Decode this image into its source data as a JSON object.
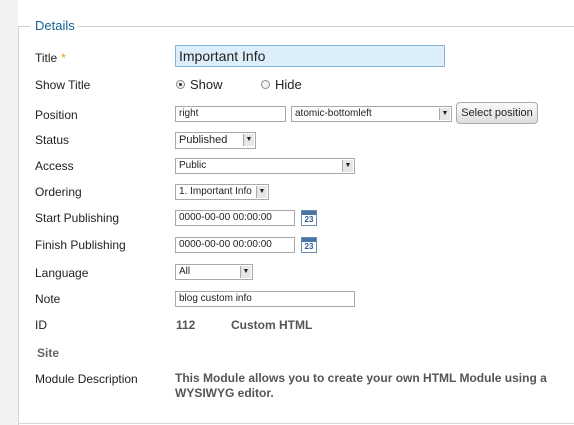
{
  "fieldset": {
    "legend": "Details"
  },
  "fields": {
    "title": {
      "label": "Title",
      "required_mark": "*",
      "value": "Important Info"
    },
    "show_title": {
      "label": "Show Title",
      "options": [
        "Show",
        "Hide"
      ],
      "selected": "Show"
    },
    "position": {
      "label": "Position",
      "value": "right",
      "select_value": "atomic-bottomleft",
      "button_label": "Select position"
    },
    "status": {
      "label": "Status",
      "value": "Published"
    },
    "access": {
      "label": "Access",
      "value": "Public"
    },
    "ordering": {
      "label": "Ordering",
      "value": "1. Important Info"
    },
    "start_publishing": {
      "label": "Start Publishing",
      "value": "0000-00-00 00:00:00",
      "calendar_day": "23"
    },
    "finish_publishing": {
      "label": "Finish Publishing",
      "value": "0000-00-00 00:00:00",
      "calendar_day": "23"
    },
    "language": {
      "label": "Language",
      "value": "All"
    },
    "note": {
      "label": "Note",
      "value": "blog custom info"
    },
    "id": {
      "label": "ID",
      "value": "112",
      "type": "Custom HTML"
    },
    "site": {
      "label": "Site"
    },
    "module_description": {
      "label": "Module Description",
      "value": "This Module allows you to create your own HTML Module using a WYSIWYG editor."
    }
  },
  "icons": {
    "calendar": "calendar-icon",
    "dropdown": "chevron-down-icon"
  },
  "colors": {
    "legend": "#146295",
    "required": "#e8a000",
    "title_input_bg": "#dceefa"
  }
}
